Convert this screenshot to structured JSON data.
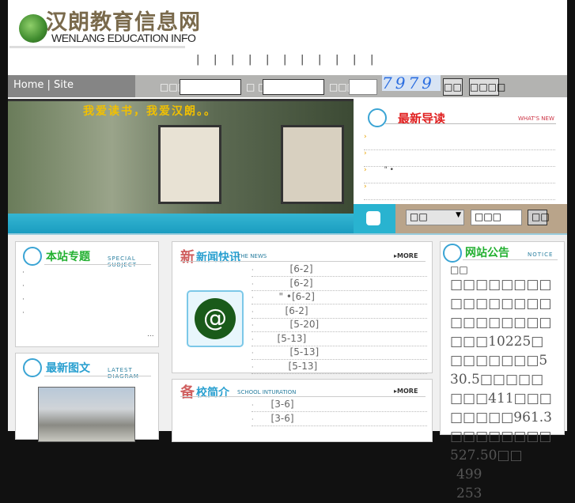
{
  "header": {
    "logo_cn": "汉朗教育信息网",
    "logo_en": "WENLANG EDUCATION INFO",
    "nav_separators": [
      "|",
      "|",
      "|",
      "|",
      "|",
      "|",
      "|",
      "|",
      "|",
      "|",
      "|"
    ]
  },
  "toolbar": {
    "links": "Home | Site",
    "username_label": "□□□",
    "password_label": "□ □",
    "code_label": "□□□",
    "captcha": "7979",
    "login_button": "□□",
    "register_button": "□□□□"
  },
  "banner": {
    "title": "我爱读书，我爱汉朗。。"
  },
  "whats_new": {
    "title": "最新导读",
    "subtitle": "WHAT'S NEW",
    "items": [
      "",
      "",
      "\" •",
      ""
    ],
    "bullet": "›"
  },
  "search": {
    "select_value": "□□",
    "input_value": "□□□",
    "button": "□□"
  },
  "special": {
    "title": "本站专题",
    "subtitle": "SPECIAL SUBJECT",
    "items": [
      "·",
      "·",
      "·",
      "·"
    ],
    "more": "..."
  },
  "latest_image": {
    "title": "最新图文",
    "subtitle": "LATEST DIAGRAM"
  },
  "news": {
    "title": "新闻快讯",
    "subtitle": "THE NEWS",
    "more": "MORE",
    "items": [
      "[6-2]",
      "[6-2]",
      "\" •[6-2]",
      "[6-2]",
      "[5-20]",
      "[5-13]",
      "[5-13]",
      "[5-13]"
    ]
  },
  "intro": {
    "title": "校简介",
    "subtitle": "SCHOOL INTURATION",
    "more": "MORE",
    "items": [
      "[3-6]",
      "[3-6]"
    ]
  },
  "notice": {
    "title": "网站公告",
    "subtitle": "NOTICE",
    "heading": "□□",
    "text": "□□□□□□□□□□□□□□□□□□□□□□□□□□□10225□□□□□□□□530.5□□□□□□□□411□□□□□□□□961.3□□□□□□□□527.50□□",
    "n1": "499",
    "n2": "253"
  },
  "colors": {
    "accent_blue": "#2aa0d0",
    "title_red": "#e02020",
    "cyan": "#29b3d0",
    "tan": "#b9a48a"
  }
}
